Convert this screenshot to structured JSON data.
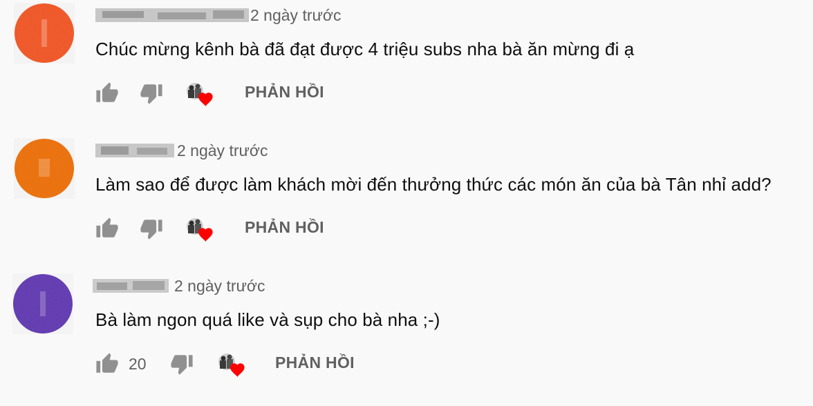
{
  "comments": [
    {
      "time": "2 ngày trước",
      "text": "Chúc mừng kênh bà đã đạt được 4 triệu subs nha bà ăn mừng đi ạ",
      "avatar_color": "#f4511e",
      "like_count": "",
      "reply_label": "PHẢN HỒI"
    },
    {
      "time": "2 ngày trước",
      "text": "Làm sao để được làm khách mời đến thưởng thức các món ăn của bà Tân nhỉ add?",
      "avatar_color": "#ef6c00",
      "like_count": "",
      "reply_label": "PHẢN HỒI"
    },
    {
      "time": "2 ngày trước",
      "text": "Bà làm ngon quá like và sụp cho bà  nha ;-)",
      "avatar_color": "#5e35b1",
      "like_count": "20",
      "reply_label": "PHẢN HỒI"
    }
  ],
  "icons": {
    "like": "thumbs-up-icon",
    "dislike": "thumbs-down-icon",
    "creator_heart": "creator-heart-icon"
  },
  "colors": {
    "background": "#f9f9f9",
    "text": "#0f0f0f",
    "secondary_text": "#606060",
    "icon": "#909090",
    "heart": "#ff0000"
  }
}
